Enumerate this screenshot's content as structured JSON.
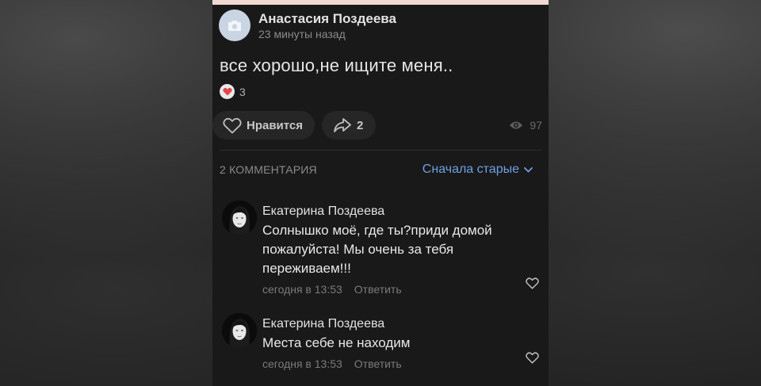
{
  "post": {
    "author": "Анастасия Поздеева",
    "time": "23 минуты назад",
    "text": "все хорошо,не ищите меня..",
    "reaction_count": "3"
  },
  "actions": {
    "like_label": "Нравится",
    "share_count": "2",
    "views": "97"
  },
  "comments_section": {
    "count_label": "2 КОММЕНТАРИЯ",
    "sort_label": "Сначала старые",
    "reply_label": "Ответить",
    "items": [
      {
        "author": "Екатерина Поздеева",
        "text_lines": [
          "Солнышко моё, где ты?приди домой",
          "пожалуйста! Мы очень за тебя",
          "переживаем!!!"
        ],
        "time": "сегодня в 13:53"
      },
      {
        "author": "Екатерина Поздеева",
        "text_lines": [
          "Места себе не находим"
        ],
        "time": "сегодня в 13:53"
      }
    ]
  },
  "icons": {
    "avatar_placeholder": "camera-icon",
    "reaction": "heart-icon",
    "like": "heart-outline-icon",
    "share": "share-arrow-icon",
    "views": "eye-icon",
    "sort": "chevron-down-icon",
    "comment_like": "heart-outline-icon"
  },
  "colors": {
    "background": "#191919",
    "accent_link": "#6fa0e0",
    "reaction_red": "#e64646",
    "button_bg": "#262626"
  }
}
